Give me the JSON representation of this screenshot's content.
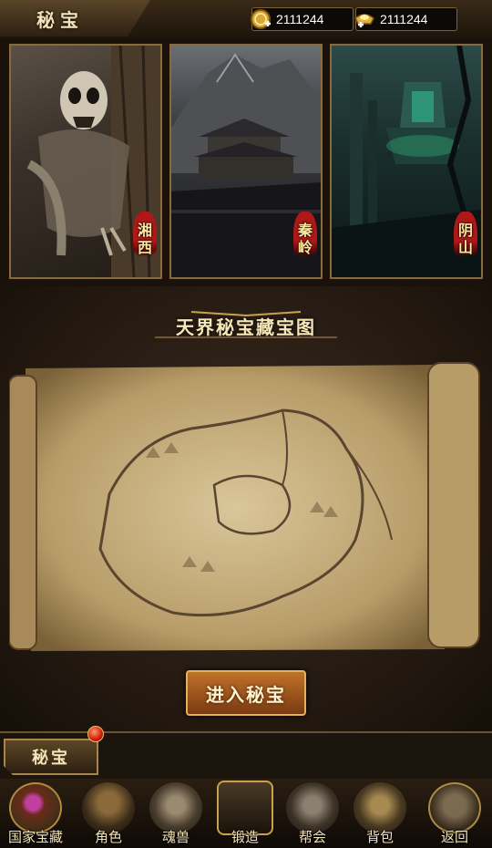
{
  "header": {
    "title": "秘宝",
    "currency": [
      {
        "icon": "gold-coin-icon",
        "value": "2111244"
      },
      {
        "icon": "gold-ingot-icon",
        "value": "2111244"
      }
    ]
  },
  "cards": [
    {
      "name": "湘西",
      "chars": [
        "湘",
        "西"
      ],
      "icon": "skeleton-monster-art"
    },
    {
      "name": "秦岭",
      "chars": [
        "秦",
        "岭"
      ],
      "icon": "mountain-palace-art"
    },
    {
      "name": "阴山",
      "chars": [
        "阴",
        "山"
      ],
      "icon": "haunted-ruins-art"
    }
  ],
  "map": {
    "title": "天界秘宝藏宝图"
  },
  "enter_button": {
    "label": "进入秘宝"
  },
  "tab": {
    "label": "秘宝"
  },
  "nav": [
    {
      "label": "国家宝藏",
      "icon": "treasure-orb-icon"
    },
    {
      "label": "角色",
      "icon": "warrior-helmet-icon"
    },
    {
      "label": "魂兽",
      "icon": "beast-head-icon"
    },
    {
      "label": "锻造",
      "icon": "anvil-hammer-icon"
    },
    {
      "label": "帮会",
      "icon": "guild-banner-icon"
    },
    {
      "label": "背包",
      "icon": "backpack-icon"
    },
    {
      "label": "返回",
      "icon": "back-arrow-icon"
    }
  ],
  "colors": {
    "gold": "#c9a24e",
    "button": "#a85420",
    "badge": "#d01a0a"
  }
}
